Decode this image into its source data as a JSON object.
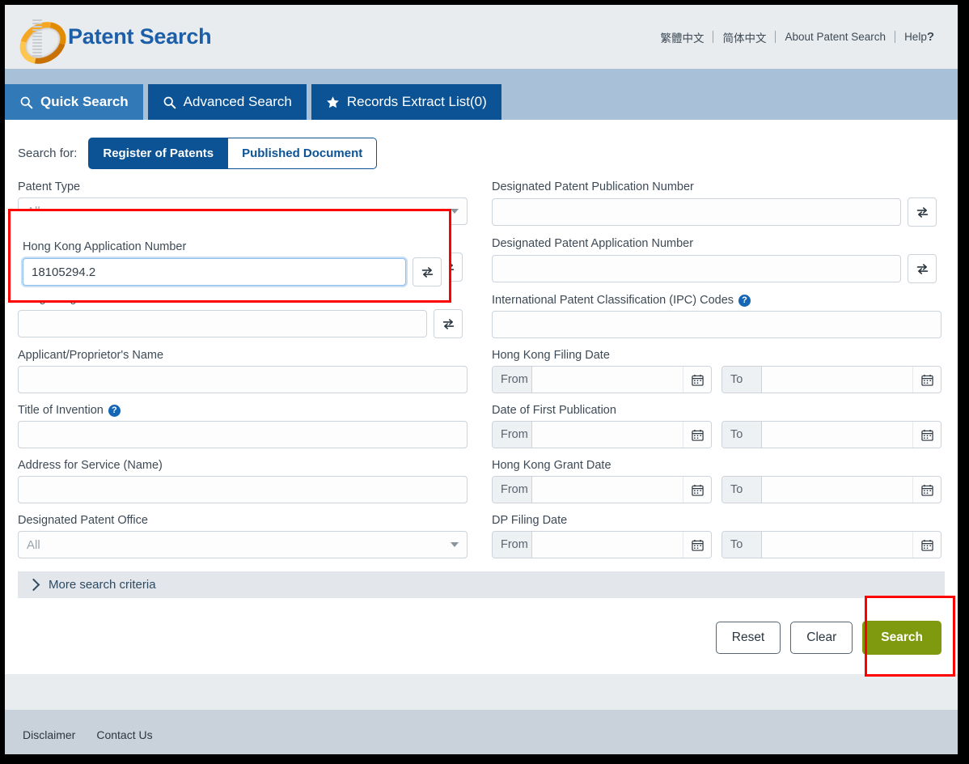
{
  "header": {
    "app_title": "Patent Search",
    "logo_icon": "patent-ring-logo",
    "nav": [
      {
        "label": "繁體中文",
        "name": "nav-traditional-chinese"
      },
      {
        "label": "简体中文",
        "name": "nav-simplified-chinese"
      },
      {
        "label": "About Patent Search",
        "name": "nav-about"
      },
      {
        "label": "Help",
        "name": "nav-help",
        "suffix": "?"
      }
    ]
  },
  "tabs": [
    {
      "label": "Quick Search",
      "icon": "magnifier-icon",
      "active": true
    },
    {
      "label": "Advanced Search",
      "icon": "magnifier-icon",
      "active": false
    },
    {
      "label": "Records Extract List(0)",
      "icon": "star-icon",
      "active": false
    }
  ],
  "search_for": {
    "label": "Search for:",
    "options": [
      {
        "label": "Register of Patents",
        "selected": true
      },
      {
        "label": "Published Document",
        "selected": false
      }
    ]
  },
  "left_column": {
    "patent_type": {
      "label": "Patent Type",
      "value": "All",
      "icon": "chevron-down-icon"
    },
    "hk_application_number": {
      "label": "Hong Kong Application Number",
      "value": "18105294.2",
      "placeholder": "",
      "swap_icon": "swap-arrows-icon",
      "focused": true
    },
    "hk_patent_publication_number": {
      "label": "Hong Kong Patent/Publication Number",
      "value": "",
      "placeholder": "",
      "swap_icon": "swap-arrows-icon"
    },
    "applicant_name": {
      "label": "Applicant/Proprietor's Name",
      "value": "",
      "placeholder": ""
    },
    "title_of_invention": {
      "label": "Title of Invention",
      "value": "",
      "placeholder": "",
      "help_icon": "help-question-icon"
    },
    "address_for_service": {
      "label": "Address for Service (Name)",
      "value": "",
      "placeholder": ""
    },
    "designated_patent_office": {
      "label": "Designated Patent Office",
      "value": "All",
      "icon": "chevron-down-icon"
    }
  },
  "right_column": {
    "dp_publication_number": {
      "label": "Designated Patent Publication Number",
      "value": "",
      "placeholder": "",
      "swap_icon": "swap-arrows-icon"
    },
    "dp_application_number": {
      "label": "Designated Patent Application Number",
      "value": "",
      "placeholder": "",
      "swap_icon": "swap-arrows-icon"
    },
    "ipc_codes": {
      "label": "International Patent Classification (IPC) Codes",
      "value": "",
      "placeholder": "",
      "help_icon": "help-question-icon"
    },
    "date_ranges": [
      {
        "label": "Hong Kong Filing Date",
        "from_label": "From",
        "from_value": "",
        "to_label": "To",
        "to_value": "",
        "calendar_icon": "calendar-icon"
      },
      {
        "label": "Date of First Publication",
        "from_label": "From",
        "from_value": "",
        "to_label": "To",
        "to_value": "",
        "calendar_icon": "calendar-icon"
      },
      {
        "label": "Hong Kong Grant Date",
        "from_label": "From",
        "from_value": "",
        "to_label": "To",
        "to_value": "",
        "calendar_icon": "calendar-icon"
      },
      {
        "label": "DP Filing Date",
        "from_label": "From",
        "from_value": "",
        "to_label": "To",
        "to_value": "",
        "calendar_icon": "calendar-icon"
      }
    ]
  },
  "more_criteria": {
    "label": "More search criteria",
    "icon": "chevron-right-icon"
  },
  "actions": {
    "reset_label": "Reset",
    "clear_label": "Clear",
    "search_label": "Search"
  },
  "footer": {
    "links": [
      {
        "label": "Disclaimer"
      },
      {
        "label": "Contact Us"
      }
    ]
  },
  "colors": {
    "brand_blue": "#0b5394",
    "tab_active_blue": "#3279b7",
    "tabbar_band": "#a8c0d8",
    "header_grey": "#e9ecef",
    "search_green": "#7f9a0e",
    "annotation_red": "#ff0000",
    "logo_gold": "#f5a623",
    "help_blue": "#1566b5"
  },
  "annotations": [
    {
      "name": "hk-application-number-highlight"
    },
    {
      "name": "search-button-highlight"
    }
  ]
}
